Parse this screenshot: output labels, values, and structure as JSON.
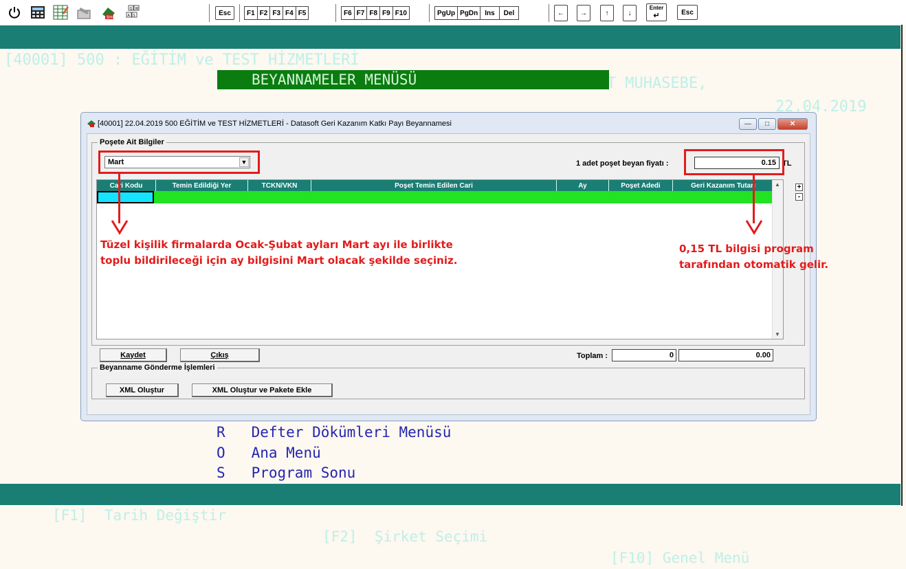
{
  "toolbar": {
    "keys_a": [
      "Esc"
    ],
    "keys_f": [
      "F1",
      "F2",
      "F3",
      "F4",
      "F5"
    ],
    "keys_f2": [
      "F6",
      "F7",
      "F8",
      "F9",
      "F10"
    ],
    "keys_nav": [
      "PgUp",
      "PgDn",
      "Ins",
      "Del"
    ],
    "key_enter": "Enter",
    "key_esc2": "Esc",
    "keypad_letters": [
      "Q",
      "W",
      "A",
      "S"
    ]
  },
  "header": {
    "company": "[40001] 500 : EĞİTİM ve TEST HİZMETLERİ",
    "app": "DATASOFT MUHASEBE,",
    "date": "22.04.2019"
  },
  "menu_title": "BEYANNAMELER MENÜSÜ",
  "dialog": {
    "title": "[40001] 22.04.2019  500  EĞİTİM ve TEST HİZMETLERİ  -  Datasoft Geri Kazanım Katkı Payı Beyannamesi",
    "group1_legend": "Poşete Ait Bilgiler",
    "month_value": "Mart",
    "price_label": "1 adet poşet beyan fiyatı :",
    "price_value": "0.15",
    "price_unit": "TL",
    "columns": [
      "Cari Kodu",
      "Temin Edildiği Yer",
      "TCKN/VKN",
      "Poşet Temin Edilen Cari",
      "Ay",
      "Poşet Adedi",
      "Geri Kazanım Tutarı"
    ],
    "save_label": "Kaydet",
    "exit_label": "Çıkış",
    "total_label": "Toplam :",
    "total_count": "0",
    "total_amount": "0.00",
    "group2_legend": "Beyanname Gönderme İşlemleri",
    "xml_create": "XML Oluştur",
    "xml_create_pack": "XML Oluştur ve Pakete Ekle"
  },
  "annotations": {
    "left_line1": "Tüzel kişilik firmalarda Ocak-Şubat ayları Mart ayı ile birlikte",
    "left_line2": "toplu bildirileceği için ay bilgisini Mart olacak şekilde seçiniz.",
    "right_line1": "0,15 TL bilgisi program",
    "right_line2": "tarafından otomatik gelir.",
    "color": "#e31b1b"
  },
  "bottom_menu": [
    {
      "key": "R",
      "label": "Defter Dökümleri Menüsü"
    },
    {
      "key": "O",
      "label": "Ana Menü"
    },
    {
      "key": "S",
      "label": "Program Sonu"
    }
  ],
  "footer": {
    "f1": "[F1]  Tarih Değiştir",
    "f2": "[F2]  Şirket Seçimi",
    "f10": "[F10] Genel Menü"
  },
  "colors": {
    "header_bg": "#1a7e74",
    "menu_title_bg": "#0a7c10",
    "grid_row": "#22e322",
    "selected_cell": "#14e4ff"
  }
}
